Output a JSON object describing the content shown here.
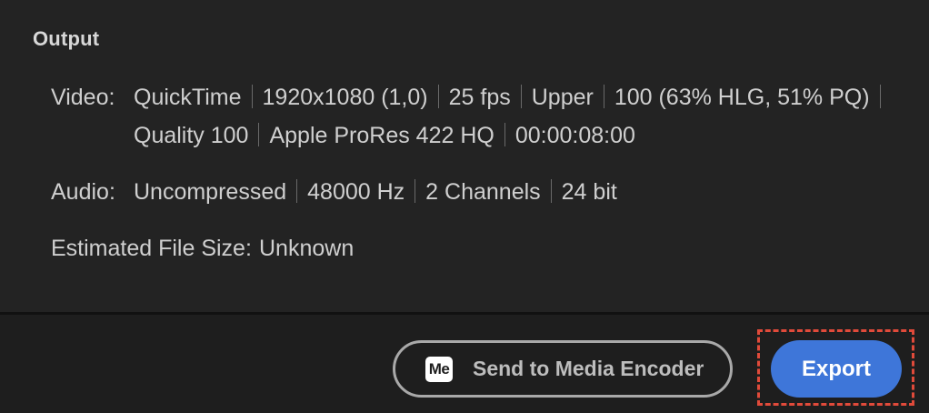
{
  "output": {
    "title": "Output",
    "video": {
      "label": "Video:",
      "line1": [
        "QuickTime",
        "1920x1080 (1,0)",
        "25 fps",
        "Upper",
        "100 (63% HLG, 51% PQ)"
      ],
      "line2": [
        "Quality 100",
        "Apple ProRes 422 HQ",
        "00:00:08:00"
      ]
    },
    "audio": {
      "label": "Audio:",
      "values": [
        "Uncompressed",
        "48000 Hz",
        "2 Channels",
        "24 bit"
      ]
    },
    "file_size": {
      "label": "Estimated File Size:",
      "value": "Unknown"
    }
  },
  "footer": {
    "media_encoder_icon": "Me",
    "media_encoder_label": "Send to Media Encoder",
    "export_label": "Export",
    "colors": {
      "export_bg": "#3e76d9",
      "highlight": "#e04a3a"
    }
  }
}
